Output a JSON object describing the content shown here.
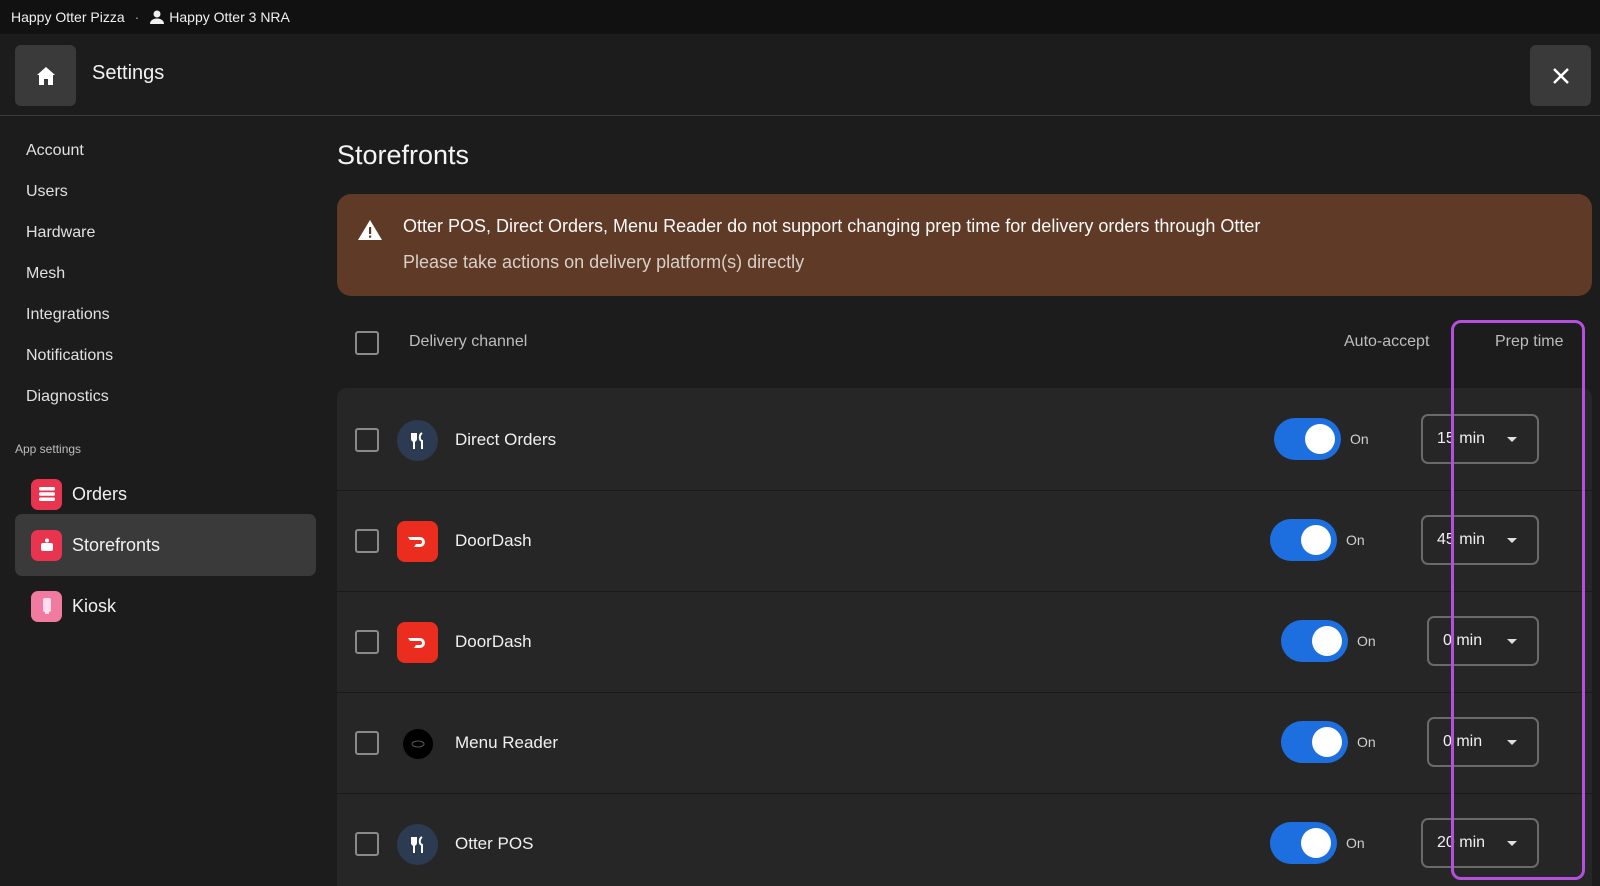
{
  "topbar": {
    "brand": "Happy Otter Pizza",
    "separator": "·",
    "location": "Happy Otter 3 NRA"
  },
  "header": {
    "title": "Settings"
  },
  "sidebar": {
    "items": [
      "Account",
      "Users",
      "Hardware",
      "Mesh",
      "Integrations",
      "Notifications",
      "Diagnostics"
    ],
    "section_label": "App settings",
    "apps": [
      {
        "label": "Orders",
        "color": "#e8344e"
      },
      {
        "label": "Storefronts",
        "color": "#e8344e",
        "active": true
      },
      {
        "label": "Kiosk",
        "color": "#f07aa0"
      }
    ]
  },
  "page": {
    "title": "Storefronts",
    "alert": {
      "line1": "Otter POS, Direct Orders, Menu Reader do not support changing prep time for delivery orders through Otter",
      "line2": "Please take actions on delivery platform(s) directly"
    }
  },
  "table": {
    "headers": {
      "channel": "Delivery channel",
      "auto_accept": "Auto-accept",
      "prep_time": "Prep time"
    },
    "rows": [
      {
        "name": "Direct Orders",
        "icon": "fork-knife-icon",
        "toggle_label": "On",
        "prep": "15 min"
      },
      {
        "name": "DoorDash",
        "icon": "doordash-icon",
        "toggle_label": "On",
        "prep": "45 min"
      },
      {
        "name": "DoorDash",
        "icon": "doordash-icon",
        "toggle_label": "On",
        "prep": "0 min"
      },
      {
        "name": "Menu Reader",
        "icon": "menu-reader-icon",
        "toggle_label": "On",
        "prep": "0 min"
      },
      {
        "name": "Otter POS",
        "icon": "fork-knife-icon",
        "toggle_label": "On",
        "prep": "20 min"
      }
    ]
  },
  "colors": {
    "accent": "#1d6fe0",
    "alert_bg": "#5f3a27",
    "highlight": "#b44fe0",
    "doordash": "#eb2d1f"
  }
}
